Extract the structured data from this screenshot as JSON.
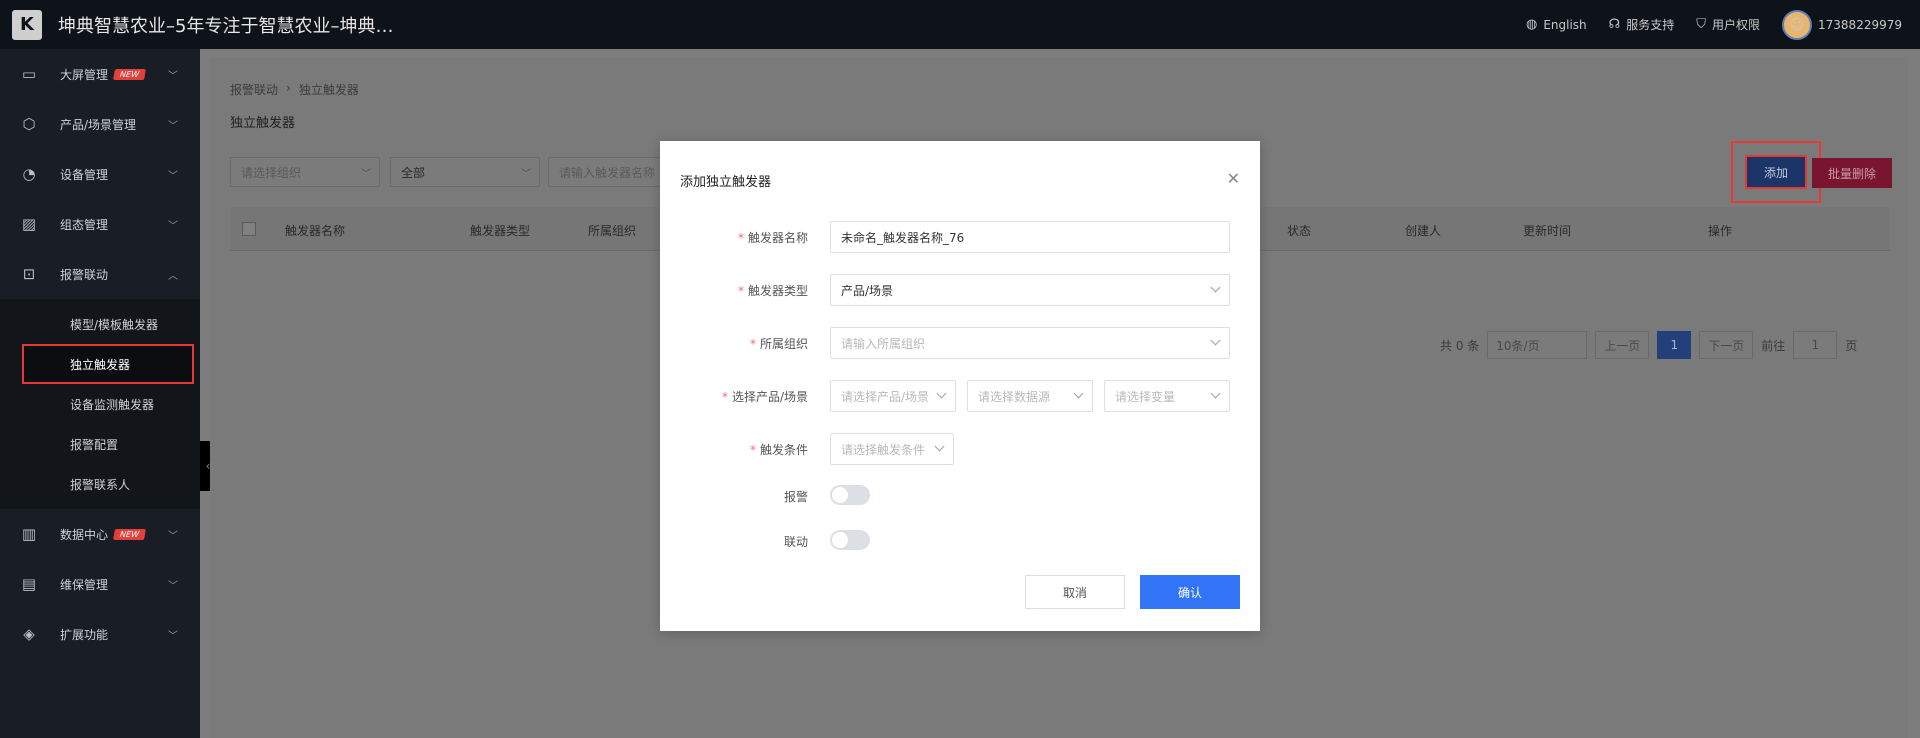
{
  "app": {
    "title": "坤典智慧农业–5年专注于智慧农业–坤典…",
    "logo_text": "K"
  },
  "topbar": {
    "language": "English",
    "support": "服务支持",
    "permissions": "用户权限",
    "user": "17388229979"
  },
  "sidebar": {
    "items": [
      {
        "label": "大屏管理",
        "icon": "monitor-icon",
        "badge": "NEW"
      },
      {
        "label": "产品/场景管理",
        "icon": "cube-icon"
      },
      {
        "label": "设备管理",
        "icon": "pie-icon"
      },
      {
        "label": "组态管理",
        "icon": "image-icon"
      },
      {
        "label": "报警联动",
        "icon": "alarm-icon"
      },
      {
        "label": "数据中心",
        "icon": "bar-chart-icon",
        "badge": "NEW"
      },
      {
        "label": "维保管理",
        "icon": "maintenance-icon"
      },
      {
        "label": "扩展功能",
        "icon": "layers-icon"
      }
    ],
    "sub_items": [
      {
        "label": "模型/模板触发器"
      },
      {
        "label": "独立触发器"
      },
      {
        "label": "设备监测触发器"
      },
      {
        "label": "报警配置"
      },
      {
        "label": "报警联系人"
      }
    ]
  },
  "content": {
    "breadcrumb": [
      "报警联动",
      "独立触发器"
    ],
    "page_title": "独立触发器",
    "filters": {
      "org_placeholder": "请选择组织",
      "type_value": "全部",
      "name_placeholder": "请输入触发器名称"
    },
    "buttons": {
      "add": "添加",
      "batch_delete": "批量删除"
    },
    "table_headers": [
      "触发器名称",
      "触发器类型",
      "所属组织",
      "状态",
      "创建人",
      "更新时间",
      "操作"
    ],
    "pagination": {
      "total": "共 0 条",
      "page_size": "10条/页",
      "prev": "上一页",
      "current": "1",
      "next": "下一页",
      "goto_label": "前往",
      "goto_value": "1",
      "page_suffix": "页"
    }
  },
  "modal": {
    "title": "添加独立触发器",
    "fields": {
      "name_label": "触发器名称",
      "name_value": "未命名_触发器名称_76",
      "type_label": "触发器类型",
      "type_value": "产品/场景",
      "org_label": "所属组织",
      "org_placeholder": "请输入所属组织",
      "product_label": "选择产品/场景",
      "product_placeholder": "请选择产品/场景",
      "datasource_placeholder": "请选择数据源",
      "variable_placeholder": "请选择变量",
      "condition_label": "触发条件",
      "condition_placeholder": "请选择触发条件",
      "alarm_label": "报警",
      "link_label": "联动"
    },
    "buttons": {
      "cancel": "取消",
      "confirm": "确认"
    }
  },
  "colors": {
    "primary": "#3274f6",
    "danger": "#e53935",
    "sidebar_bg": "#191d25",
    "topbar_bg": "#0e1219"
  }
}
